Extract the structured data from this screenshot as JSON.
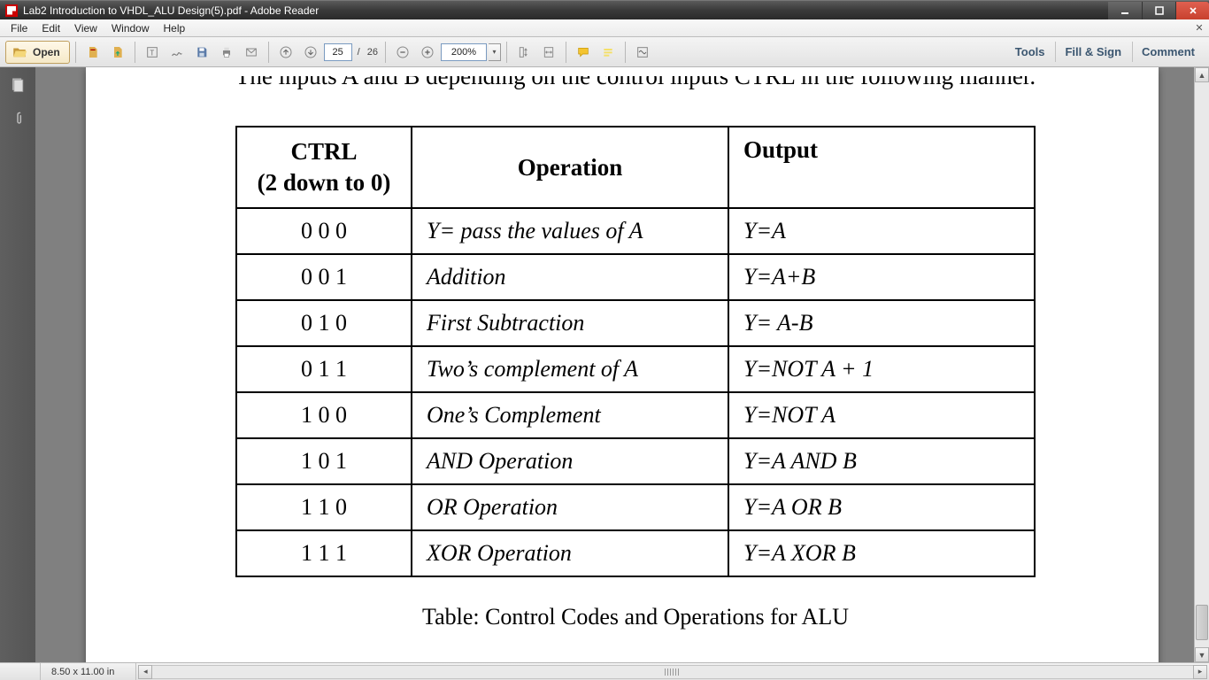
{
  "app": {
    "title": "Lab2 Introduction to VHDL_ALU Design(5).pdf - Adobe Reader"
  },
  "menu": {
    "file": "File",
    "edit": "Edit",
    "view": "View",
    "window": "Window",
    "help": "Help"
  },
  "toolbar": {
    "open_label": "Open",
    "page_current": "25",
    "page_sep": "/",
    "page_total": "26",
    "zoom_value": "200%"
  },
  "panels": {
    "tools": "Tools",
    "fill_sign": "Fill & Sign",
    "comment": "Comment"
  },
  "document": {
    "headers": {
      "ctrl_line1": "CTRL",
      "ctrl_line2": "(2 down to 0)",
      "operation": "Operation",
      "output": "Output"
    },
    "rows": [
      {
        "ctrl": "0 0 0",
        "op": "Y= pass the values of A",
        "out": "Y=A"
      },
      {
        "ctrl": "0 0 1",
        "op": "Addition",
        "out": "Y=A+B"
      },
      {
        "ctrl": "0 1 0",
        "op": "First Subtraction",
        "out": "Y= A-B"
      },
      {
        "ctrl": "0 1 1",
        "op": "Two’s complement of A",
        "out": "Y=NOT A + 1"
      },
      {
        "ctrl": "1 0 0",
        "op": "One’s Complement",
        "out": "Y=NOT A"
      },
      {
        "ctrl": "1 0 1",
        "op": "AND Operation",
        "out": "Y=A AND B"
      },
      {
        "ctrl": "1 1 0",
        "op": "OR Operation",
        "out": "Y=A OR B"
      },
      {
        "ctrl": "1 1 1",
        "op": "XOR Operation",
        "out": "Y=A XOR B"
      }
    ],
    "caption": "Table: Control Codes and Operations for ALU"
  },
  "status": {
    "page_dim": "8.50 x 11.00 in"
  }
}
